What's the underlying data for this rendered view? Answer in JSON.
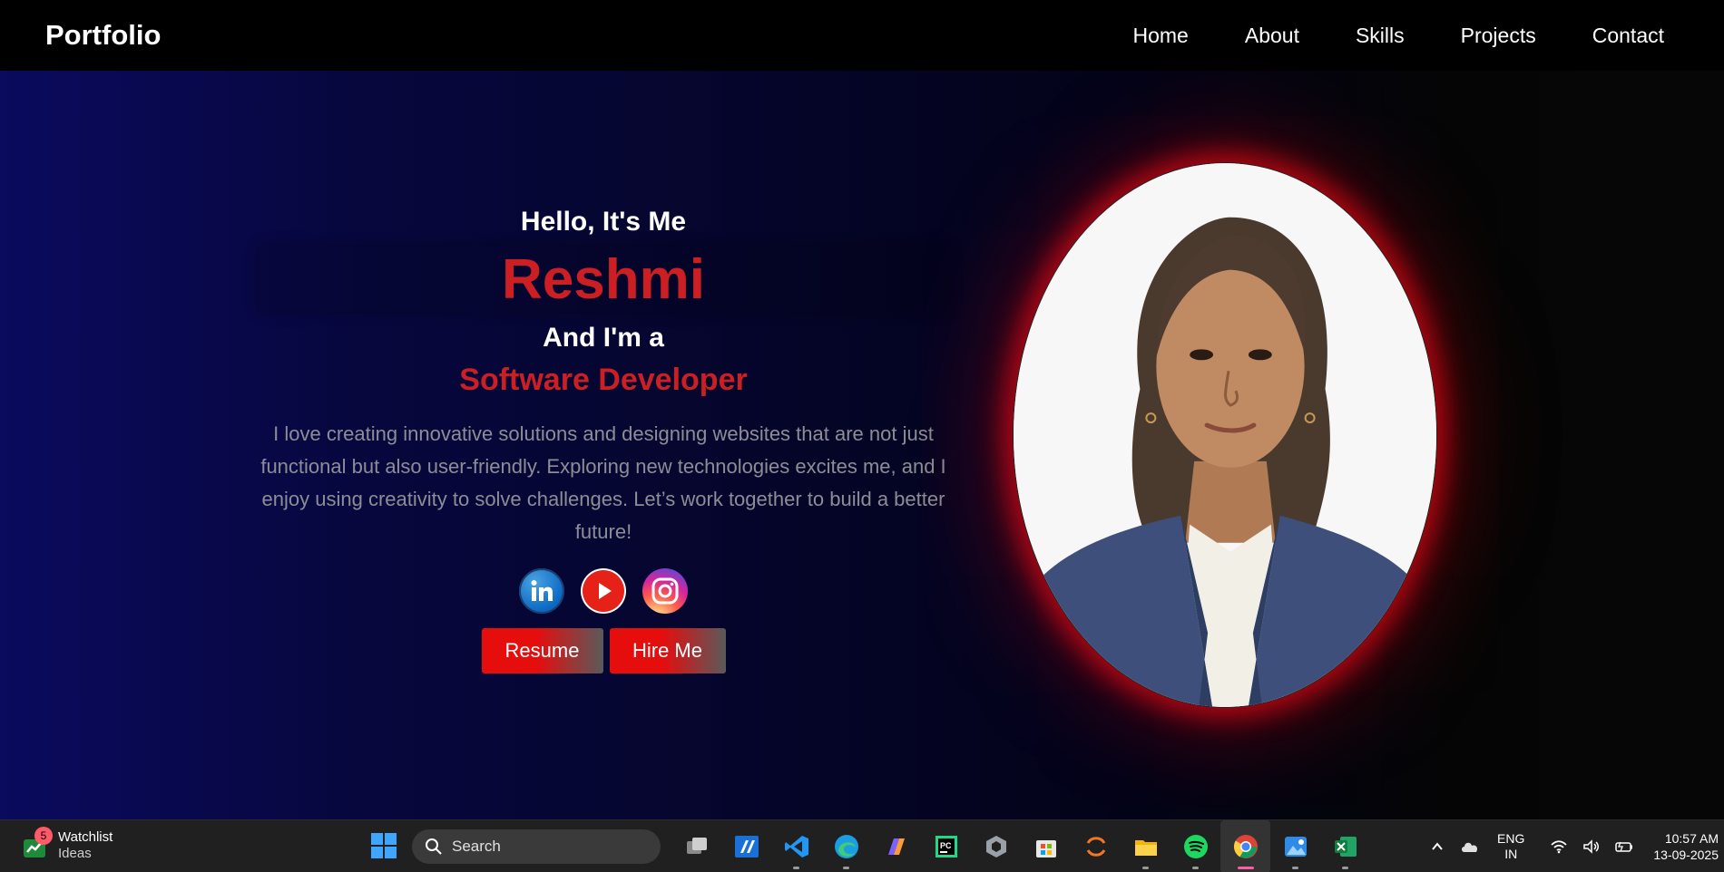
{
  "navbar": {
    "brand": "Portfolio",
    "links": [
      "Home",
      "About",
      "Skills",
      "Projects",
      "Contact"
    ]
  },
  "hero": {
    "greeting": "Hello, It's Me",
    "name": "Reshmi",
    "intro": "And I'm a",
    "role": "Software Developer",
    "about": "I love creating innovative solutions and designing websites that are not just functional but also user-friendly. Exploring new technologies excites me, and I enjoy using creativity to solve challenges. Let’s work together to build a better future!",
    "socials": [
      "linkedin-icon",
      "youtube-icon",
      "instagram-icon"
    ],
    "buttons": {
      "resume": "Resume",
      "hire": "Hire Me"
    }
  },
  "taskbar": {
    "widget": {
      "badge": "5",
      "title": "Watchlist",
      "subtitle": "Ideas"
    },
    "search_placeholder": "Search",
    "apps": [
      "task-view",
      "azure-ml",
      "vs-code",
      "edge",
      "copilot",
      "pycharm",
      "unity",
      "microsoft-store",
      "jupyter",
      "file-explorer",
      "spotify",
      "chrome",
      "photos",
      "excel"
    ],
    "language": {
      "line1": "ENG",
      "line2": "IN"
    },
    "clock": {
      "time": "10:57 AM",
      "date": "13-09-2025"
    }
  },
  "colors": {
    "accent_red": "#cc1f24",
    "nav_bg": "#000000",
    "hero_gradient_left": "#0a0a5e",
    "taskbar_bg": "#202020"
  }
}
